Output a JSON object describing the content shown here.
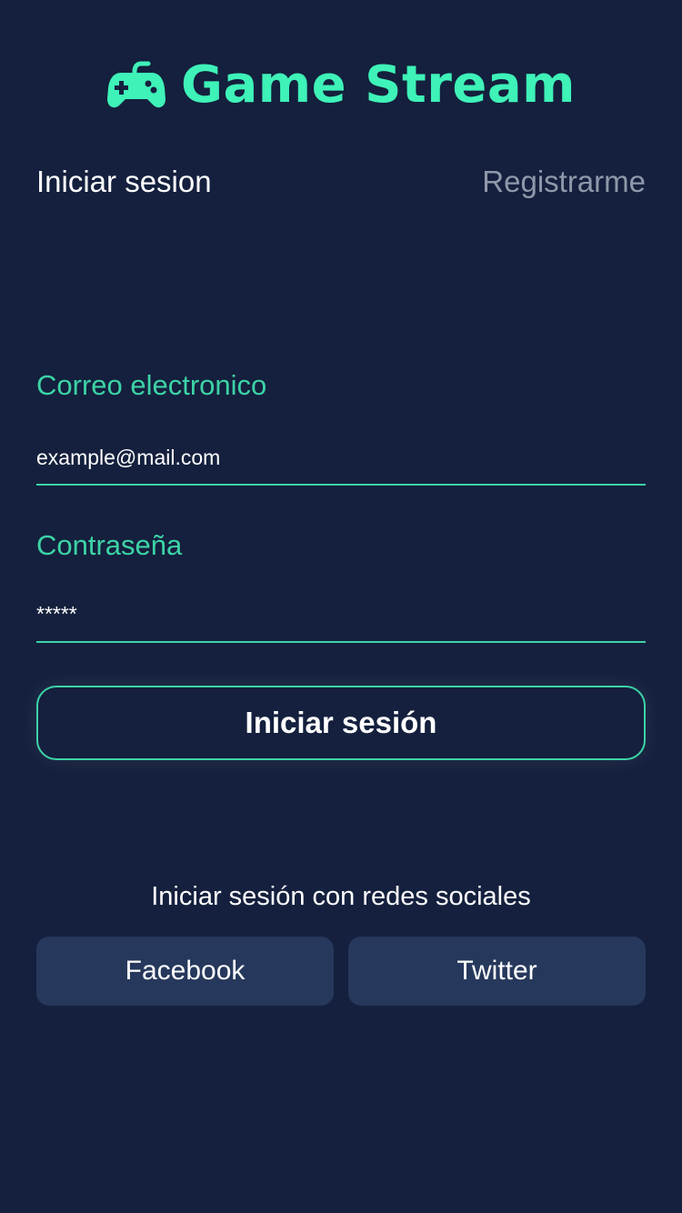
{
  "app": {
    "title": "Game Stream",
    "icon": "gamepad-icon",
    "accent_color": "#3ef2b8",
    "background_color": "#14203d"
  },
  "tabs": {
    "login_label": "Iniciar sesion",
    "register_label": "Registrarme",
    "active": "login"
  },
  "form": {
    "email_label": "Correo electronico",
    "email_placeholder": "example@mail.com",
    "password_label": "Contraseña",
    "password_placeholder": "*****",
    "submit_label": "Iniciar sesión"
  },
  "social": {
    "title": "Iniciar sesión con redes sociales",
    "facebook_label": "Facebook",
    "twitter_label": "Twitter",
    "button_color": "#26385c"
  }
}
